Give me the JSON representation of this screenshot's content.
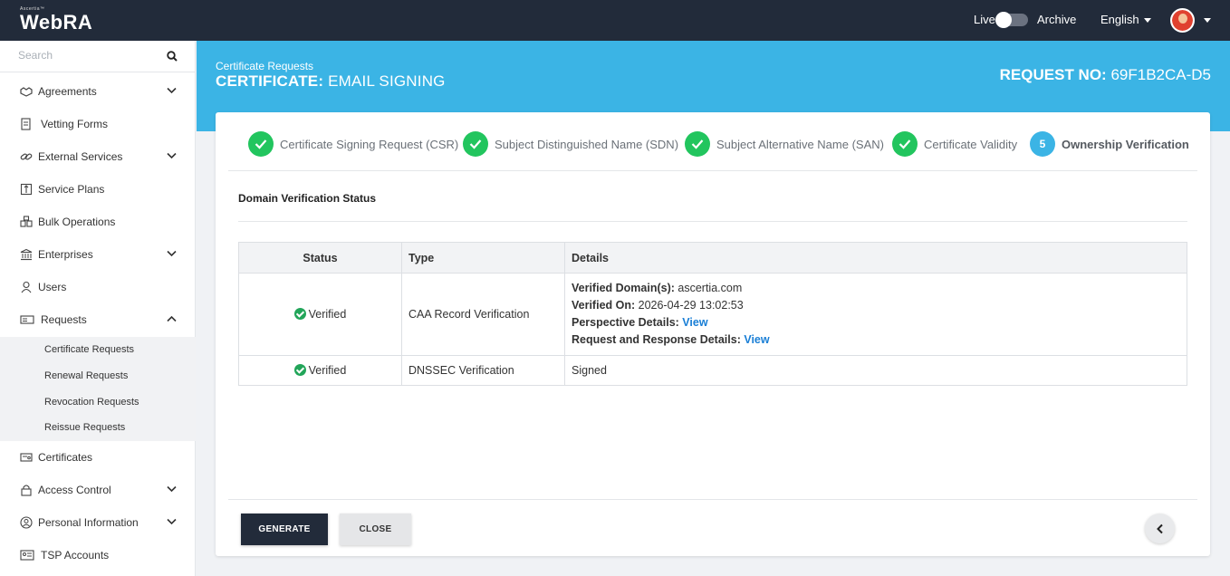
{
  "app": {
    "brand_small": "Ascertia™",
    "brand": "WebRA"
  },
  "topbar": {
    "live": "Live",
    "archive": "Archive",
    "language": "English"
  },
  "sidebar": {
    "search_placeholder": "Search",
    "items": [
      {
        "label": "Agreements",
        "icon": "handshake-icon",
        "expandable": true
      },
      {
        "label": "Vetting Forms",
        "icon": "form-icon",
        "expandable": false
      },
      {
        "label": "External Services",
        "icon": "link-icon",
        "expandable": true
      },
      {
        "label": "Service Plans",
        "icon": "plan-icon",
        "expandable": false
      },
      {
        "label": "Bulk Operations",
        "icon": "bulk-icon",
        "expandable": false
      },
      {
        "label": "Enterprises",
        "icon": "bank-icon",
        "expandable": true
      },
      {
        "label": "Users",
        "icon": "user-icon",
        "expandable": false
      },
      {
        "label": "Requests",
        "icon": "requests-icon",
        "expandable": true,
        "expanded": true
      },
      {
        "label": "Certificates",
        "icon": "certificate-icon",
        "expandable": false
      },
      {
        "label": "Access Control",
        "icon": "lock-icon",
        "expandable": true
      },
      {
        "label": "Personal Information",
        "icon": "person-circle-icon",
        "expandable": true
      },
      {
        "label": "TSP Accounts",
        "icon": "account-card-icon",
        "expandable": false
      }
    ],
    "requests_sub": [
      "Certificate Requests",
      "Renewal Requests",
      "Revocation Requests",
      "Reissue Requests"
    ]
  },
  "header": {
    "breadcrumb": "Certificate Requests",
    "title_prefix": "CERTIFICATE:",
    "title_rest": " EMAIL SIGNING",
    "request_prefix": "REQUEST NO:",
    "request_no": " 69F1B2CA-D5"
  },
  "steps": [
    {
      "label": "Certificate Signing Request (CSR)",
      "done": true
    },
    {
      "label": "Subject Distinguished Name (SDN)",
      "done": true
    },
    {
      "label": "Subject Alternative Name (SAN)",
      "done": true
    },
    {
      "label": "Certificate Validity",
      "done": true
    },
    {
      "number": "5",
      "label": "Ownership Verification",
      "done": false
    }
  ],
  "section": {
    "title": "Domain Verification Status"
  },
  "table": {
    "headers": [
      "Status",
      "Type",
      "Details"
    ],
    "rows": [
      {
        "status": "Verified",
        "type": "CAA Record Verification",
        "details": {
          "domains_label": "Verified Domain(s):",
          "domains_value": " ascertia.com",
          "on_label": "Verified On:",
          "on_value": " 2026-04-29 13:02:53",
          "perspective_label": "Perspective Details:",
          "perspective_link": "View",
          "reqresp_label": "Request and Response Details:",
          "reqresp_link": "View"
        }
      },
      {
        "status": "Verified",
        "type": "DNSSEC Verification",
        "details_text": "Signed"
      }
    ]
  },
  "buttons": {
    "generate": "GENERATE",
    "close": "CLOSE"
  },
  "colors": {
    "topbar": "#222b3a",
    "banner": "#3bb4e5",
    "success": "#22c55e",
    "link": "#1a7fd6"
  }
}
